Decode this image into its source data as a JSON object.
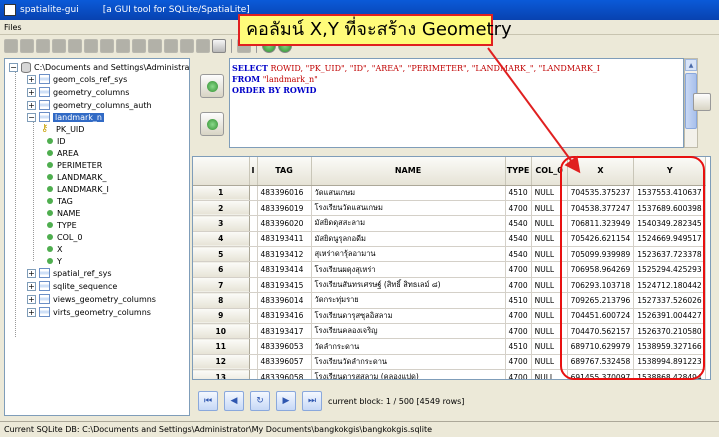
{
  "window": {
    "title": "spatialite-gui",
    "subtitle": "[a GUI tool for SQLite/SpatiaLite]"
  },
  "menu": {
    "files": "Files"
  },
  "tree": {
    "root": "C:\\Documents and Settings\\Administrat",
    "items": [
      "geom_cols_ref_sys",
      "geometry_columns",
      "geometry_columns_auth",
      "landmark_n",
      "spatial_ref_sys",
      "sqlite_sequence",
      "views_geometry_columns",
      "virts_geometry_columns"
    ],
    "columns": [
      "PK_UID",
      "ID",
      "AREA",
      "PERIMETER",
      "LANDMARK_",
      "LANDMARK_I",
      "TAG",
      "NAME",
      "TYPE",
      "COL_0",
      "X",
      "Y"
    ]
  },
  "sql": {
    "select_kw": "SELECT",
    "select_cols": " ROWID, \"PK_UID\", \"ID\", \"AREA\", \"PERIMETER\", \"LANDMARK_\", \"LANDMARK_I",
    "from_kw": "FROM",
    "from_table": " \"landmark_n\"",
    "order_kw": "ORDER BY",
    "order_col": " ROWID"
  },
  "grid": {
    "headers": [
      "",
      "I",
      "TAG",
      "NAME",
      "TYPE",
      "COL_0",
      "X",
      "Y"
    ],
    "rows": [
      [
        "1",
        "",
        "483396016",
        "วัดแสนเกษม",
        "4510",
        "NULL",
        "704535.375237",
        "1537553.410637"
      ],
      [
        "2",
        "",
        "483396019",
        "โรงเรียนวัดแสนเกษม",
        "4700",
        "NULL",
        "704538.377247",
        "1537689.600398"
      ],
      [
        "3",
        "",
        "483396020",
        "มัสยิดดุสสะลาม",
        "4540",
        "NULL",
        "706811.323949",
        "1540349.282345"
      ],
      [
        "4",
        "",
        "483193411",
        "มัสยิดนูรุลกอดีม",
        "4540",
        "NULL",
        "705426.621154",
        "1524669.949517"
      ],
      [
        "5",
        "",
        "483193412",
        "สุเหร่าดารุ้ลอามาน",
        "4540",
        "NULL",
        "705099.939989",
        "1523637.723378"
      ],
      [
        "6",
        "",
        "483193414",
        "โรงเรียนผดุงสุเหร่า",
        "4700",
        "NULL",
        "706958.964269",
        "1525294.425293"
      ],
      [
        "7",
        "",
        "483193415",
        "โรงเรียนสันทรเศรษฐ์ (สิทธิ์ สิทธเลม์ ๘)",
        "4700",
        "NULL",
        "706293.103718",
        "1524712.180442"
      ],
      [
        "8",
        "",
        "483396014",
        "วัดกระทุ่มราย",
        "4510",
        "NULL",
        "709265.213796",
        "1527337.526026"
      ],
      [
        "9",
        "",
        "483193416",
        "โรงเรียนดารุสซุลอิสลาม",
        "4700",
        "NULL",
        "704451.600724",
        "1526391.004427"
      ],
      [
        "10",
        "",
        "483193417",
        "โรงเรียนคลองเจริญ",
        "4700",
        "NULL",
        "704470.562157",
        "1526370.210580"
      ],
      [
        "11",
        "",
        "483396053",
        "วัดลำกระดาน",
        "4510",
        "NULL",
        "689710.629979",
        "1538959.327166"
      ],
      [
        "12",
        "",
        "483396057",
        "โรงเรียนวัดลำกระดาน",
        "4700",
        "NULL",
        "689767.532458",
        "1538994.891223"
      ],
      [
        "13",
        "",
        "483396058",
        "โรงเรียนดารุสสลาม (คลองแปด)",
        "4700",
        "NULL",
        "691455.370097",
        "1538868.428494"
      ]
    ]
  },
  "nav": {
    "label": "current block: 1 / 500 [4549 rows]"
  },
  "status": {
    "text": "Current SQLite DB: C:\\Documents and Settings\\Administrator\\My Documents\\bangkokgis\\bangkokgis.sqlite"
  },
  "callout": {
    "text": "คอลัมน์ X,Y ที่จะสร้าง Geometry"
  },
  "colors": {
    "accent": "#e02020",
    "callout_bg": "#fffc7a",
    "selection": "#316ac5"
  }
}
